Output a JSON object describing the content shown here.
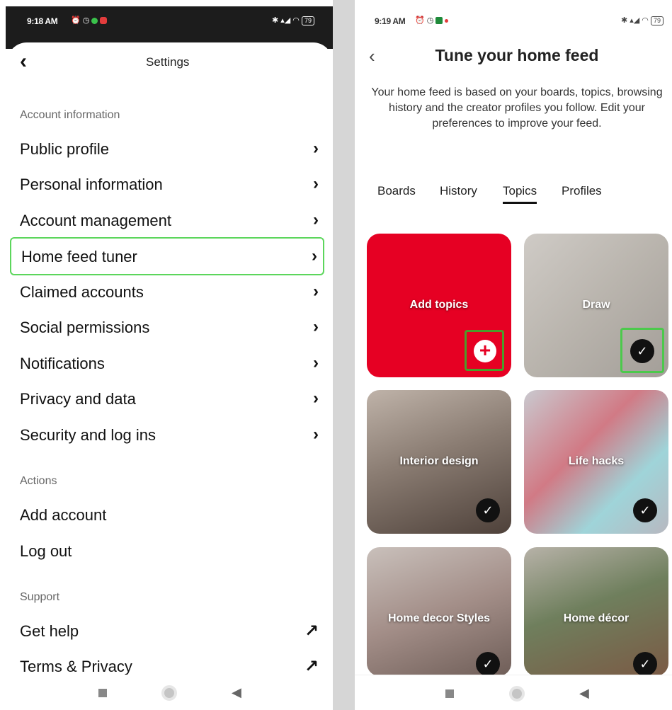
{
  "left": {
    "status": {
      "time": "9:18 AM",
      "left_icons": "⏰ ◷",
      "right_icons": "✱ ▴◢ ◠",
      "battery": "79"
    },
    "header": {
      "title": "Settings"
    },
    "sections": {
      "account": "Account information",
      "actions": "Actions",
      "support": "Support"
    },
    "items": [
      {
        "label": "Public profile",
        "icon": "chevron-right"
      },
      {
        "label": "Personal information",
        "icon": "chevron-right"
      },
      {
        "label": "Account management",
        "icon": "chevron-right"
      },
      {
        "label": "Home feed tuner",
        "icon": "chevron-right",
        "highlighted": true
      },
      {
        "label": "Claimed accounts",
        "icon": "chevron-right"
      },
      {
        "label": "Social permissions",
        "icon": "chevron-right"
      },
      {
        "label": "Notifications",
        "icon": "chevron-right"
      },
      {
        "label": "Privacy and data",
        "icon": "chevron-right"
      },
      {
        "label": "Security and log ins",
        "icon": "chevron-right"
      }
    ],
    "actions": [
      {
        "label": "Add account"
      },
      {
        "label": "Log out"
      }
    ],
    "support": [
      {
        "label": "Get help",
        "icon": "external-arrow"
      },
      {
        "label": "Terms & Privacy",
        "icon": "external-arrow"
      }
    ]
  },
  "right": {
    "status": {
      "time": "9:19 AM",
      "left_icons": "⏰ ◷",
      "right_icons": "✱ ▴◢ ◠",
      "battery": "79"
    },
    "header": {
      "title": "Tune your home feed",
      "description": "Your home feed is based on your boards, topics, browsing history and the creator profiles you follow. Edit your preferences to improve your feed."
    },
    "tabs": [
      {
        "label": "Boards"
      },
      {
        "label": "History"
      },
      {
        "label": "Topics",
        "active": true
      },
      {
        "label": "Profiles"
      }
    ],
    "topics": [
      {
        "label": "Add topics",
        "icon": "plus-icon"
      },
      {
        "label": "Draw",
        "icon": "check-icon"
      },
      {
        "label": "Interior design",
        "icon": "check-icon"
      },
      {
        "label": "Life hacks",
        "icon": "check-icon"
      },
      {
        "label": "Home decor Styles",
        "icon": "check-icon"
      },
      {
        "label": "Home décor",
        "icon": "check-icon"
      }
    ]
  },
  "colors": {
    "brand_red": "#e60023",
    "highlight_green": "#5cd65c"
  },
  "glyphs": {
    "back": "‹",
    "chevron": "›",
    "external": "↗",
    "check": "✓",
    "plus": "+",
    "nav_back": "◀"
  }
}
